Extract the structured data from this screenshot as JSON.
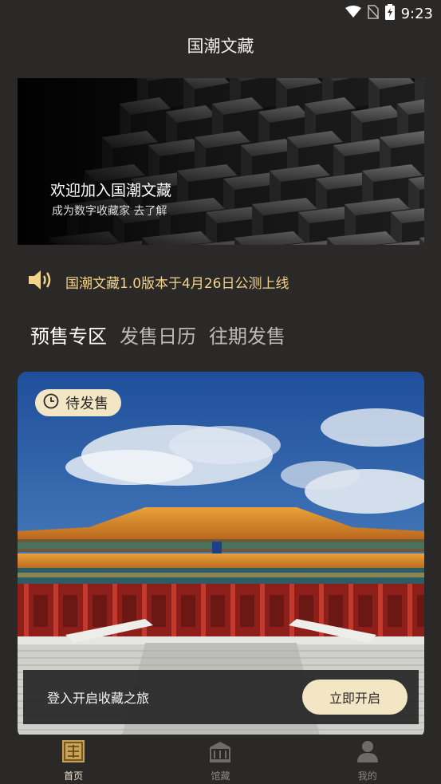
{
  "status_bar": {
    "time": "9:23",
    "icons": [
      "wifi-icon",
      "no-sim-icon",
      "battery-charging-icon"
    ]
  },
  "app": {
    "title": "国潮文藏"
  },
  "banner": {
    "title": "欢迎加入国潮文藏",
    "subtitle": "成为数字收藏家  去了解"
  },
  "notice": {
    "icon": "speaker-icon",
    "text": "国潮文藏1.0版本于4月26日公测上线",
    "color": "#f1d38b"
  },
  "tabs": [
    {
      "label": "预售专区",
      "active": true
    },
    {
      "label": "发售日历",
      "active": false
    },
    {
      "label": "往期发售",
      "active": false
    }
  ],
  "card": {
    "badge": {
      "icon": "clock-icon",
      "text": "待发售"
    },
    "login_prompt": "登入开启收藏之旅",
    "login_button": "立即开启"
  },
  "bottom_nav": [
    {
      "label": "首页",
      "icon": "home-seal-icon",
      "active": true
    },
    {
      "label": "馆藏",
      "icon": "museum-icon",
      "active": false
    },
    {
      "label": "我的",
      "icon": "user-icon",
      "active": false
    }
  ],
  "colors": {
    "background": "#2b2927",
    "accent": "#f3e6c5",
    "notice": "#f1d38b"
  }
}
